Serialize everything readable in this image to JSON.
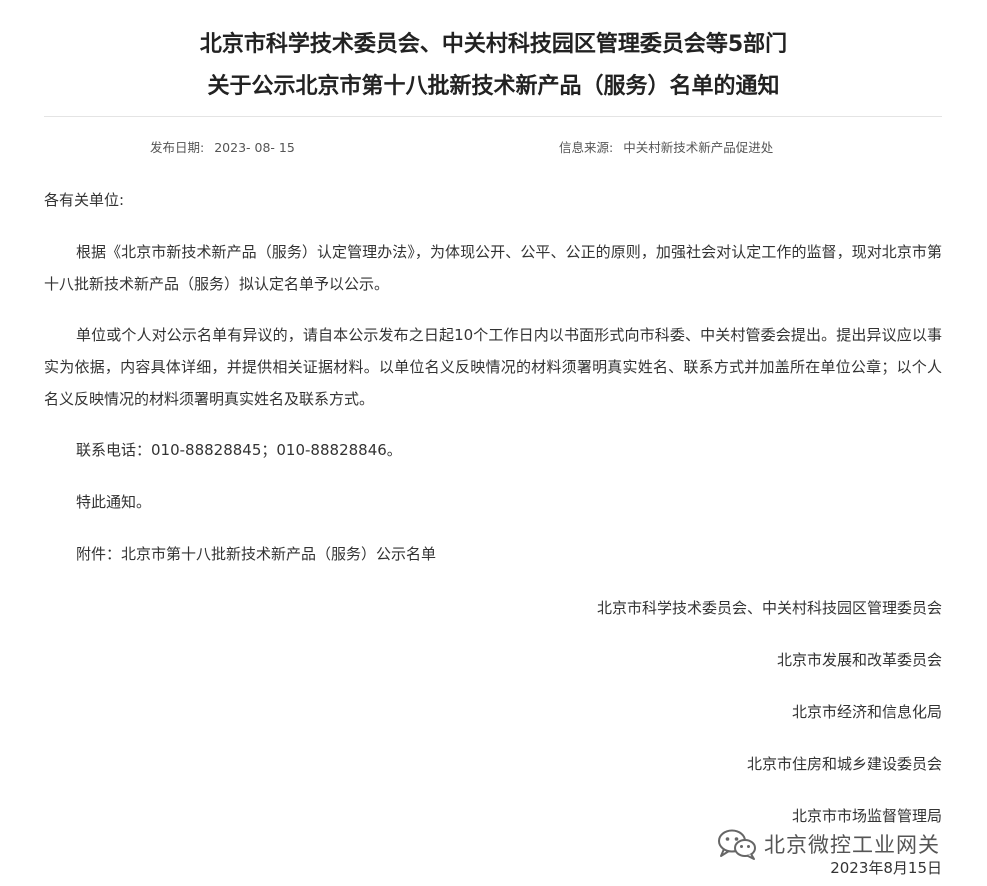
{
  "title_line1": "北京市科学技术委员会、中关村科技园区管理委员会等5部门",
  "title_line2": "关于公示北京市第十八批新技术新产品（服务）名单的通知",
  "meta": {
    "date_label": "发布日期:",
    "date_value": "2023- 08- 15",
    "source_label": "信息来源:",
    "source_value": "中关村新技术新产品促进处"
  },
  "salutation": "各有关单位:",
  "paragraphs": [
    "根据《北京市新技术新产品（服务）认定管理办法》，为体现公开、公平、公正的原则，加强社会对认定工作的监督，现对北京市第十八批新技术新产品（服务）拟认定名单予以公示。",
    "单位或个人对公示名单有异议的，请自本公示发布之日起10个工作日内以书面形式向市科委、中关村管委会提出。提出异议应以事实为依据，内容具体详细，并提供相关证据材料。以单位名义反映情况的材料须署明真实姓名、联系方式并加盖所在单位公章；以个人名义反映情况的材料须署明真实姓名及联系方式。"
  ],
  "contact": "联系电话：010-88828845；010-88828846。",
  "closing": "特此通知。",
  "attachment": "附件：北京市第十八批新技术新产品（服务）公示名单",
  "signatures": [
    "北京市科学技术委员会、中关村科技园区管理委员会",
    "北京市发展和改革委员会",
    "北京市经济和信息化局",
    "北京市住房和城乡建设委员会",
    "北京市市场监督管理局"
  ],
  "sign_date": "2023年8月15日",
  "watermark": {
    "text": "北京微控工业网关",
    "icon": "wechat-icon"
  }
}
